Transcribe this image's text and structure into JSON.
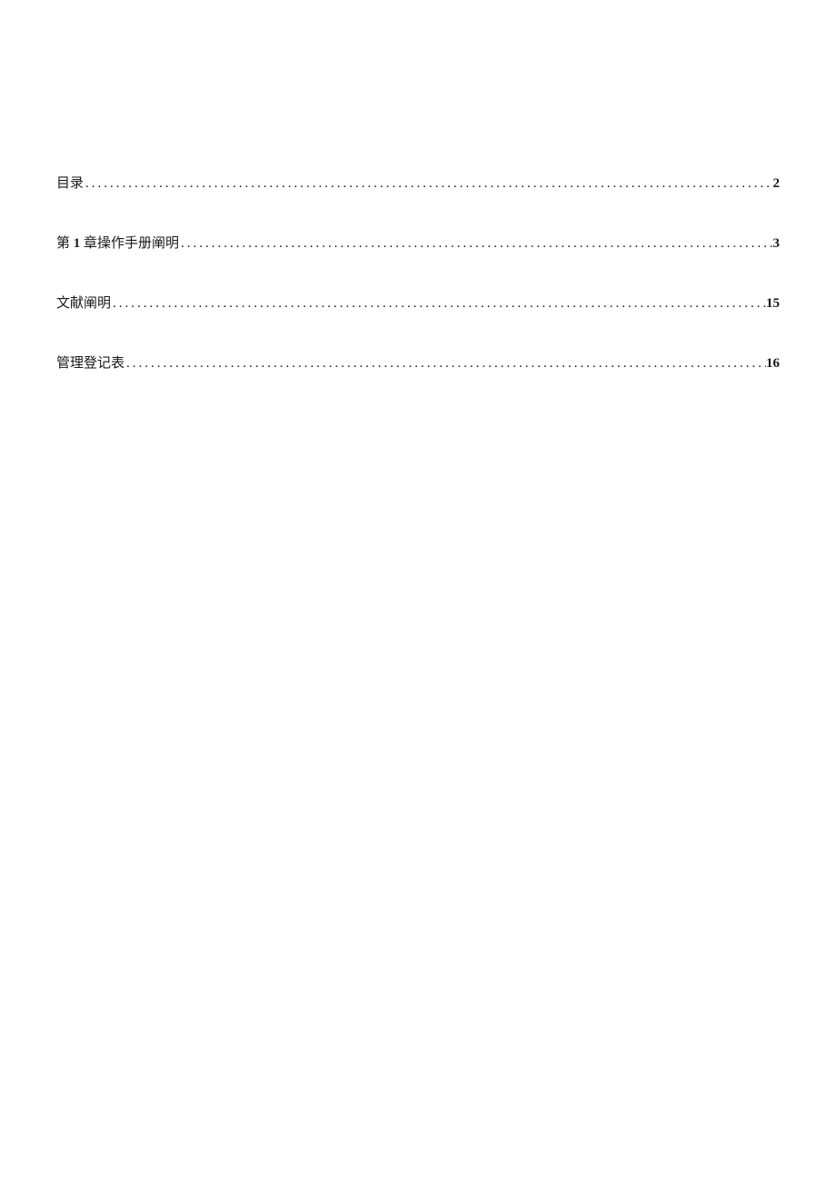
{
  "toc": {
    "entries": [
      {
        "title_prefix": "",
        "title_bold": "",
        "title_suffix": "目录",
        "page": "2"
      },
      {
        "title_prefix": "第 ",
        "title_bold": "1",
        "title_suffix": " 章操作手册阐明",
        "page": "3"
      },
      {
        "title_prefix": "",
        "title_bold": "",
        "title_suffix": "文献阐明",
        "page": "15"
      },
      {
        "title_prefix": "",
        "title_bold": "",
        "title_suffix": "管理登记表",
        "page": "16"
      }
    ]
  },
  "leader": "...................................................................................................................................."
}
